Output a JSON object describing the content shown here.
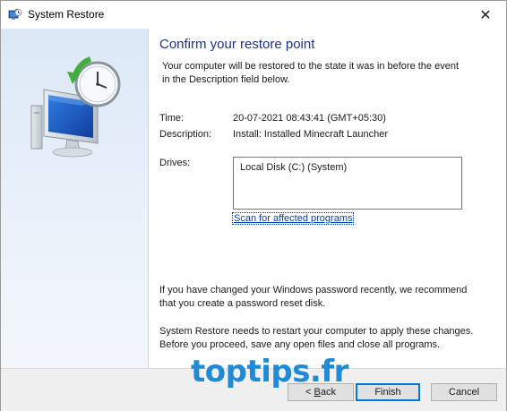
{
  "window": {
    "title": "System Restore",
    "close_glyph": "✕",
    "icon": "system-restore-icon"
  },
  "main": {
    "heading": "Confirm your restore point",
    "intro_line1": "Your computer will be restored to the state it was in before the event",
    "intro_line2": "in the Description field below.",
    "time_label": "Time:",
    "time_value": "20-07-2021 08:43:41 (GMT+05:30)",
    "description_label": "Description:",
    "description_value": "Install: Installed Minecraft Launcher",
    "drives_label": "Drives:",
    "drives_items": [
      "Local Disk (C:) (System)"
    ],
    "scan_link": "Scan for affected programs",
    "password_note_line1": "If you have changed your Windows password recently, we recommend",
    "password_note_line2": "that you create a password reset disk.",
    "restart_note_line1": "System Restore needs to restart your computer to apply these changes.",
    "restart_note_line2": "Before you proceed, save any open files and close all programs."
  },
  "footer": {
    "back_prefix": "< ",
    "back_accel": "B",
    "back_rest": "ack",
    "finish_label": "Finish",
    "cancel_label": "Cancel"
  },
  "watermark": "toptips.fr",
  "colors": {
    "heading": "#1e3287",
    "link": "#0a3fa6",
    "default_button_border": "#0078d7",
    "watermark": "#1f8bd6"
  }
}
